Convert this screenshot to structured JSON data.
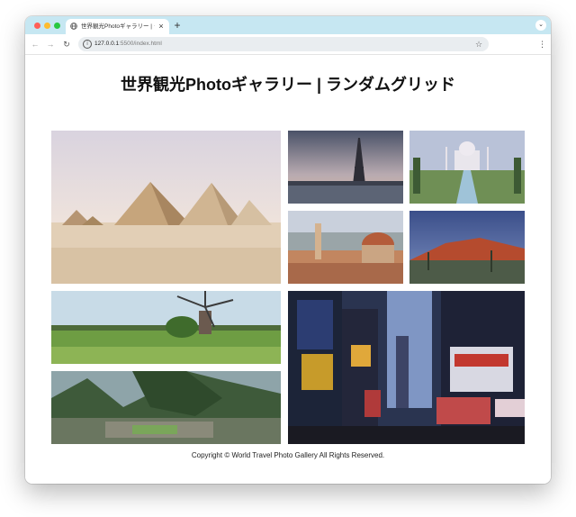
{
  "browser": {
    "tab_title": "世界観光Photoギャラリー | ラン",
    "tab_close": "×",
    "new_tab": "+",
    "tab_dropdown": "⌄",
    "back": "←",
    "forward": "→",
    "reload": "↻",
    "url_host": "127.0.0.1",
    "url_path": ":5500/index.html",
    "star": "☆",
    "menu": "⋮",
    "info": "i"
  },
  "page": {
    "title": "世界観光Photoギャラリー | ランダムグリッド",
    "footer": "Copyright © World Travel Photo Gallery All Rights Reserved."
  },
  "colors": {
    "tab_bar": "#c6e7f2",
    "omnibox": "#e9edf0"
  },
  "icons": [
    "globe-icon",
    "close-icon",
    "plus-icon",
    "chevron-down-icon",
    "back-arrow-icon",
    "forward-arrow-icon",
    "reload-icon",
    "info-icon",
    "star-icon",
    "menu-dots-icon"
  ]
}
